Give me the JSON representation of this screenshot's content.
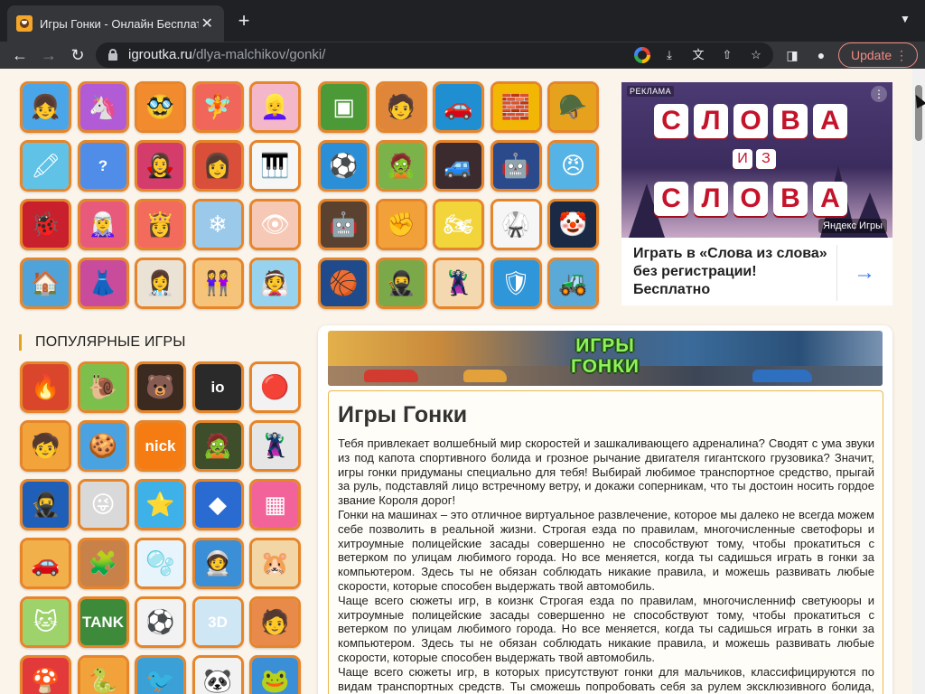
{
  "browser": {
    "tab_title": "Игры Гонки - Онлайн Бесплатно",
    "tab_close": "✕",
    "new_tab": "+",
    "url_host": "igroutka.ru",
    "url_path": "/dlya-malchikov/gonki/",
    "update_label": "Update"
  },
  "tiles_top_left": [
    {
      "icon": "👧",
      "bg": "#4aa6e8"
    },
    {
      "icon": "🦄",
      "bg": "#b25bd6"
    },
    {
      "icon": "🥸",
      "bg": "#f28a2e"
    },
    {
      "icon": "🧚",
      "bg": "#f0665a"
    },
    {
      "icon": "👱‍♀️",
      "bg": "#f4b6c9"
    },
    {
      "icon": "🖍",
      "bg": "#5fc2e6"
    },
    {
      "icon": "?",
      "bg": "#4f8de8",
      "text": true
    },
    {
      "icon": "🧛‍♀️",
      "bg": "#d43c6b"
    },
    {
      "icon": "👩",
      "bg": "#d94f3a"
    },
    {
      "icon": "🎹",
      "bg": "#f6f6f6"
    },
    {
      "icon": "🐞",
      "bg": "#c8202d"
    },
    {
      "icon": "🧝‍♀️",
      "bg": "#e85a7c"
    },
    {
      "icon": "👸",
      "bg": "#f26b5d"
    },
    {
      "icon": "❄",
      "bg": "#9bc9ea"
    },
    {
      "icon": "👁",
      "bg": "#f6c9b7"
    },
    {
      "icon": "🏠",
      "bg": "#4fa3d8"
    },
    {
      "icon": "👗",
      "bg": "#c84b9c"
    },
    {
      "icon": "👩‍⚕️",
      "bg": "#e9e2d5"
    },
    {
      "icon": "👭",
      "bg": "#f5c37a"
    },
    {
      "icon": "👰",
      "bg": "#97d3ef"
    }
  ],
  "tiles_top_middle": [
    {
      "icon": "▣",
      "bg": "#4c9a37"
    },
    {
      "icon": "🧑",
      "bg": "#e0863a"
    },
    {
      "icon": "🚗",
      "bg": "#1f8fd1"
    },
    {
      "icon": "🧱",
      "bg": "#f2b705"
    },
    {
      "icon": "🪖",
      "bg": "#e6a21c"
    },
    {
      "icon": "⚽",
      "bg": "#2a8fd6"
    },
    {
      "icon": "🧟",
      "bg": "#7bb34a"
    },
    {
      "icon": "🚙",
      "bg": "#3b2b2f"
    },
    {
      "icon": "🤖",
      "bg": "#2b4a8c"
    },
    {
      "icon": "😠",
      "bg": "#56b3e6"
    },
    {
      "icon": "🤖",
      "bg": "#5a4130"
    },
    {
      "icon": "✊",
      "bg": "#f2a13a"
    },
    {
      "icon": "🏍",
      "bg": "#f2d53b"
    },
    {
      "icon": "🥋",
      "bg": "#f6f6f6"
    },
    {
      "icon": "🤡",
      "bg": "#1b2a44"
    },
    {
      "icon": "🏀",
      "bg": "#1f4b8c"
    },
    {
      "icon": "🥷",
      "bg": "#7ba849"
    },
    {
      "icon": "🦹",
      "bg": "#f4d9b0"
    },
    {
      "icon": "🛡",
      "bg": "#2e96d9"
    },
    {
      "icon": "🚜",
      "bg": "#5aa9d6"
    }
  ],
  "popular_heading": "ПОПУЛЯРНЫЕ ИГРЫ",
  "tiles_popular": [
    {
      "icon": "🔥",
      "bg": "#d9462c"
    },
    {
      "icon": "🐌",
      "bg": "#7cbf4c"
    },
    {
      "icon": "🐻",
      "bg": "#3a2a1f"
    },
    {
      "icon": "io",
      "bg": "#2a2a2a",
      "text": true
    },
    {
      "icon": "🔴",
      "bg": "#f2f2f2"
    },
    {
      "icon": "🧒",
      "bg": "#f2a33a"
    },
    {
      "icon": "🍪",
      "bg": "#4aa3e0"
    },
    {
      "icon": "nick",
      "bg": "#f57c12",
      "text": true
    },
    {
      "icon": "🧟",
      "bg": "#3e4d2a"
    },
    {
      "icon": "🦹",
      "bg": "#e6e6e6"
    },
    {
      "icon": "🥷",
      "bg": "#1f5fb8"
    },
    {
      "icon": "😜",
      "bg": "#d9d9d9"
    },
    {
      "icon": "⭐",
      "bg": "#3db1e8"
    },
    {
      "icon": "◆",
      "bg": "#2a6bd1"
    },
    {
      "icon": "▦",
      "bg": "#f2639a"
    },
    {
      "icon": "🚗",
      "bg": "#f2b04a"
    },
    {
      "icon": "🧩",
      "bg": "#c9814a"
    },
    {
      "icon": "🫧",
      "bg": "#e8f4fb"
    },
    {
      "icon": "🧑‍🚀",
      "bg": "#3a8fd6"
    },
    {
      "icon": "🐹",
      "bg": "#f2d6a6"
    },
    {
      "icon": "🐱",
      "bg": "#9ed36b"
    },
    {
      "icon": "TANK",
      "bg": "#3d8a3a",
      "text": true
    },
    {
      "icon": "⚽",
      "bg": "#f2f2f2"
    },
    {
      "icon": "3D",
      "bg": "#cfe6f5",
      "text": true
    },
    {
      "icon": "🧑",
      "bg": "#e88a4a"
    },
    {
      "icon": "🍄",
      "bg": "#e23a3a"
    },
    {
      "icon": "🐍",
      "bg": "#f2a23a"
    },
    {
      "icon": "🐦",
      "bg": "#3aa0d6"
    },
    {
      "icon": "🐼",
      "bg": "#f2f2f2"
    },
    {
      "icon": "🐸",
      "bg": "#3a8fd6"
    }
  ],
  "ad": {
    "label": "РЕКЛАМА",
    "more": "⋮",
    "word1": [
      "С",
      "Л",
      "О",
      "В",
      "А"
    ],
    "middle": [
      "И",
      "З"
    ],
    "word2": [
      "С",
      "Л",
      "О",
      "В",
      "А"
    ],
    "brand": "Яндекс Игры",
    "text": "Играть в «Слова из слова» без регистрации! Бесплатно",
    "arrow": "→"
  },
  "article": {
    "banner_line1": "ИГРЫ",
    "banner_line2": "ГОНКИ",
    "title": "Игры Гонки",
    "paragraphs": [
      "Тебя привлекает волшебный мир скоростей и зашкаливающего адреналина? Сводят с ума звуки из под капота спортивного болида и грозное рычание двигателя гигантского грузовика? Значит, игры гонки придуманы специально для тебя! Выбирай любимое транспортное средство, прыгай за руль, подставляй лицо встречному ветру, и докажи соперникам, что ты достоин носить гордое звание Короля дорог!",
      "Гонки на машинах – это отличное виртуальное развлечение, которое мы далеко не всегда можем себе позволить в реальной жизни. Строгая езда по правилам, многочисленные светофоры и хитроумные полицейские засады совершенно не способствуют тому, чтобы прокатиться с ветерком по улицам любимого города. Но все меняется, когда ты садишься играть в гонки за компьютером. Здесь ты не обязан соблюдать никакие правила, и можешь развивать любые скорости, которые способен выдержать твой автомобиль.",
      "Чаще всего сюжеты игр, в коизнк Строгая езда по правилам, многочисленниф светуюоры и хитроумные полицейские засады совершенно не способствуют тому, чтобы прокатиться с ветерком по улицам любимого города. Но все меняется, когда ты садишься играть в гонки за компьютером. Здесь ты не обязан соблюдать никакие правила, и можешь развивать любые скорости, которые способен выдержать твой автомобиль.",
      "Чаще всего сюжеты игр, в которых присутствуют гонки для мальчиков, классифицируются по видам транспортных средств. Ты сможешь попробовать себя за рулем эксклюзивного болида, классического"
    ]
  }
}
